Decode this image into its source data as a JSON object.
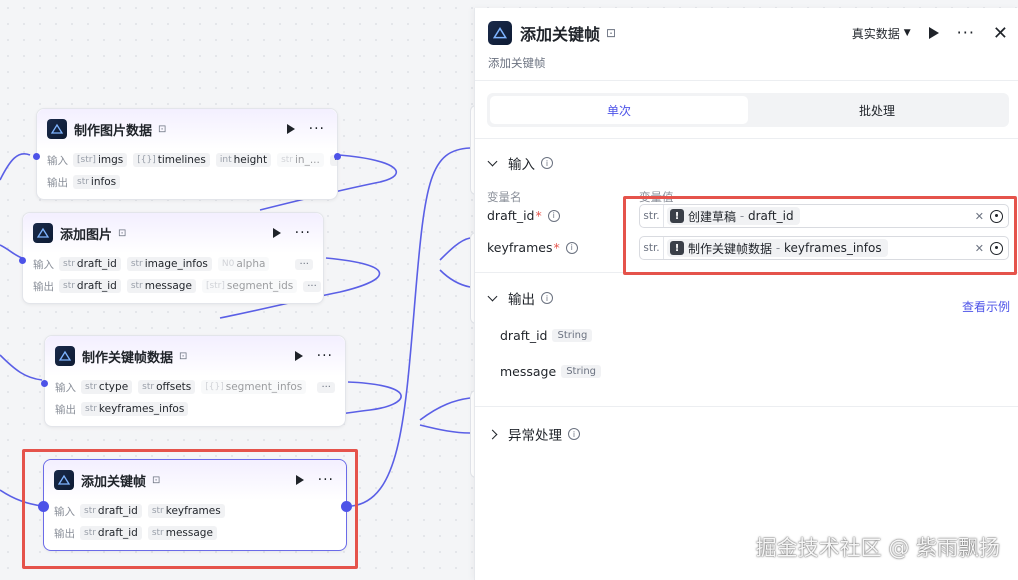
{
  "nodes": {
    "make_image_data": {
      "title": "制作图片数据",
      "in_label": "输入",
      "out_label": "输出",
      "inputs": [
        {
          "type": "[str]",
          "name": "imgs"
        },
        {
          "type": "[{}]",
          "name": "timelines"
        },
        {
          "type": "int",
          "name": "height"
        },
        {
          "type": "str",
          "name": "in_..."
        }
      ],
      "outputs": [
        {
          "type": "str",
          "name": "infos"
        }
      ]
    },
    "add_image": {
      "title": "添加图片",
      "in_label": "输入",
      "out_label": "输出",
      "inputs": [
        {
          "type": "str",
          "name": "draft_id"
        },
        {
          "type": "str",
          "name": "image_infos"
        },
        {
          "type": "N0",
          "name": "alpha"
        }
      ],
      "outputs": [
        {
          "type": "str",
          "name": "draft_id"
        },
        {
          "type": "str",
          "name": "message"
        },
        {
          "type": "[str]",
          "name": "segment_ids"
        }
      ]
    },
    "make_keyframe_data": {
      "title": "制作关键帧数据",
      "in_label": "输入",
      "out_label": "输出",
      "inputs": [
        {
          "type": "str",
          "name": "ctype"
        },
        {
          "type": "str",
          "name": "offsets"
        },
        {
          "type": "[{}]",
          "name": "segment_infos"
        }
      ],
      "outputs": [
        {
          "type": "str",
          "name": "keyframes_infos"
        }
      ]
    },
    "add_keyframes": {
      "title": "添加关键帧",
      "in_label": "输入",
      "out_label": "输出",
      "inputs": [
        {
          "type": "str",
          "name": "draft_id"
        },
        {
          "type": "str",
          "name": "keyframes"
        }
      ],
      "outputs": [
        {
          "type": "str",
          "name": "draft_id"
        },
        {
          "type": "str",
          "name": "message"
        }
      ]
    }
  },
  "panel": {
    "title": "添加关键帧",
    "subtitle": "添加关键帧",
    "data_mode": "真实数据",
    "tabs": [
      "单次",
      "批处理"
    ],
    "active_tab": "单次",
    "input_section": "输入",
    "col_name": "变量名",
    "col_value": "变量值",
    "inputs": [
      {
        "name": "draft_id",
        "type": "str.",
        "ref_node": "创建草稿",
        "ref_sep": " - ",
        "ref_var": "draft_id"
      },
      {
        "name": "keyframes",
        "type": "str.",
        "ref_node": "制作关键帧数据",
        "ref_sep": " - ",
        "ref_var": "keyframes_infos"
      }
    ],
    "output_section": "输出",
    "view_example": "查看示例",
    "outputs": [
      {
        "name": "draft_id",
        "type": "String"
      },
      {
        "name": "message",
        "type": "String"
      }
    ],
    "exception_section": "异常处理"
  },
  "watermark": "掘金技术社区 @ 紫雨飘扬",
  "colors": {
    "accent": "#4d53e8",
    "highlight": "#e5534b"
  }
}
